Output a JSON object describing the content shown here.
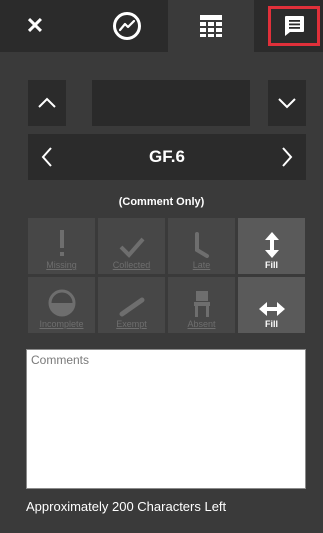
{
  "topbar": {
    "close_label": "✕",
    "tabs": [
      {
        "icon": "close-icon"
      },
      {
        "icon": "chart-icon"
      },
      {
        "icon": "grid-icon"
      },
      {
        "icon": "comment-icon"
      }
    ],
    "highlight_color": "#e0303a"
  },
  "assignment": {
    "title": "GF.6",
    "mode": "(Comment Only)"
  },
  "statuses": [
    {
      "label": "Missing",
      "icon": "exclamation-icon",
      "active": false
    },
    {
      "label": "Collected",
      "icon": "checkmark-icon",
      "active": false
    },
    {
      "label": "Late",
      "icon": "late-icon",
      "active": false
    },
    {
      "label": "Fill",
      "icon": "vertical-arrows-icon",
      "active": true
    },
    {
      "label": "Incomplete",
      "icon": "half-circle-icon",
      "active": false
    },
    {
      "label": "Exempt",
      "icon": "slash-icon",
      "active": false
    },
    {
      "label": "Absent",
      "icon": "chair-icon",
      "active": false
    },
    {
      "label": "Fill",
      "icon": "horizontal-arrows-icon",
      "active": true
    }
  ],
  "comments": {
    "placeholder": "Comments",
    "value": ""
  },
  "footer": {
    "chars_left": "Approximately 200 Characters Left"
  }
}
